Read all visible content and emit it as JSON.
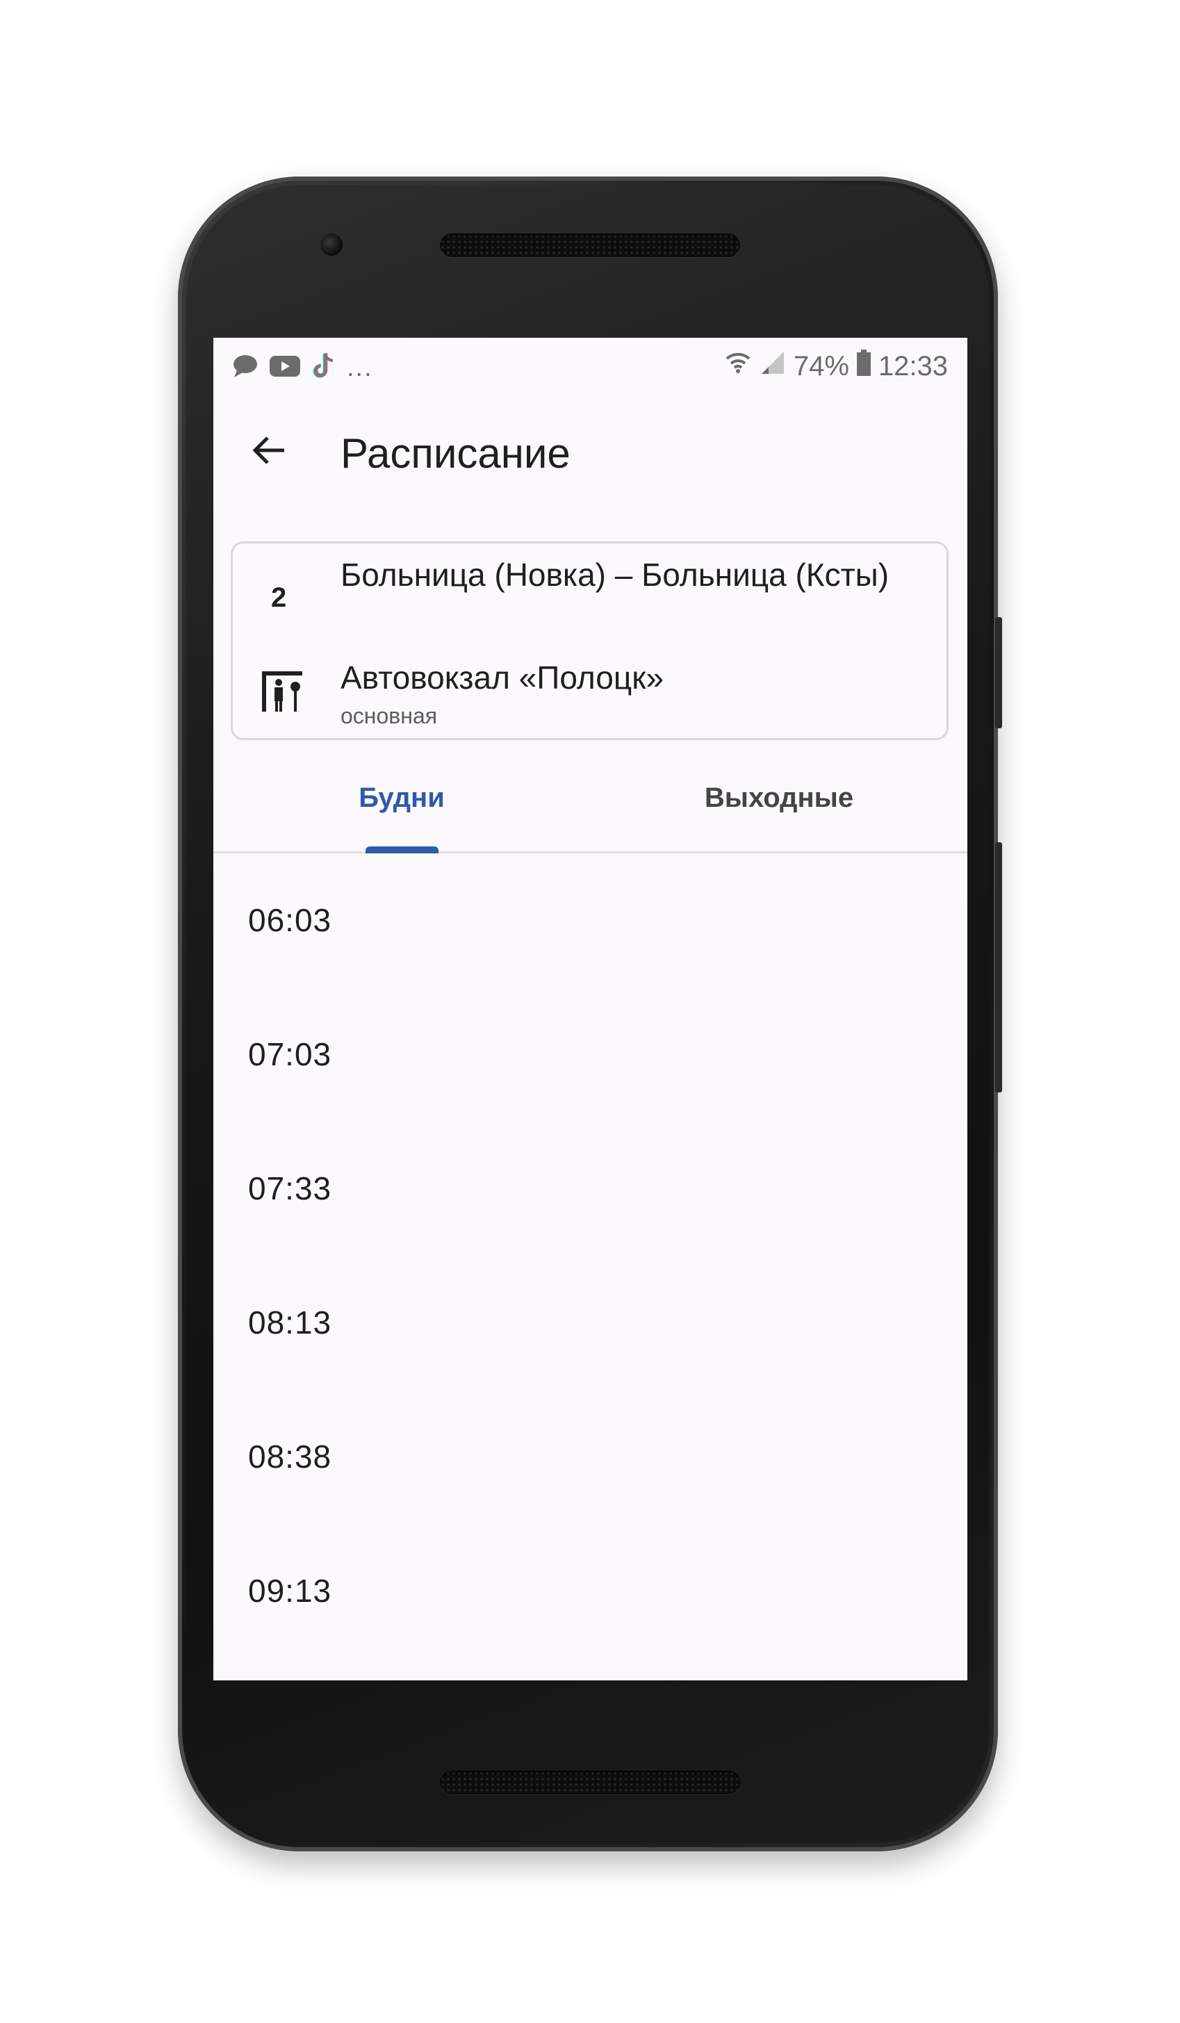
{
  "status_bar": {
    "left_icons": [
      "chat-bubble-icon",
      "youtube-icon",
      "tiktok-icon"
    ],
    "more_indicator": "...",
    "battery_percent": "74%",
    "time": "12:33"
  },
  "appbar": {
    "title": "Расписание",
    "back_icon": "arrow-left-icon"
  },
  "route": {
    "number": "2",
    "name": "Больница (Новка) – Больница (Ксты)",
    "stop_name": "Автовокзал «Полоцк»",
    "stop_type": "основная",
    "stop_icon": "bus-stop-icon"
  },
  "tabs": [
    {
      "label": "Будни",
      "active": true
    },
    {
      "label": "Выходные",
      "active": false
    }
  ],
  "times": [
    "06:03",
    "07:03",
    "07:33",
    "08:13",
    "08:38",
    "09:13"
  ],
  "colors": {
    "accent": "#2e5aa7",
    "screen_bg": "#fbf9fc",
    "text": "#1f1f1f"
  }
}
